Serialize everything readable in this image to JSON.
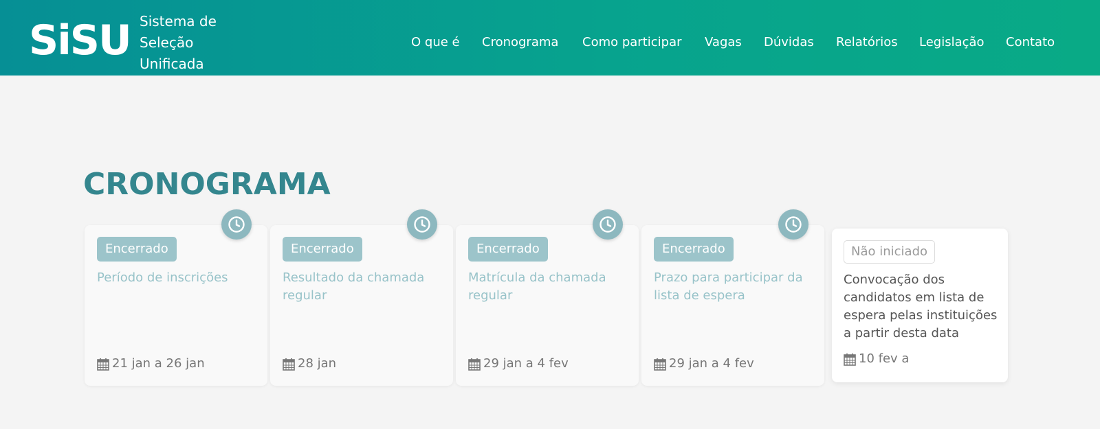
{
  "header": {
    "logo": "SiSU",
    "subtitle_lines": [
      "Sistema de",
      "Seleção",
      "Unificada"
    ],
    "nav": [
      "O que é",
      "Cronograma",
      "Como participar",
      "Vagas",
      "Dúvidas",
      "Relatórios",
      "Legislação",
      "Contato"
    ]
  },
  "section": {
    "title": "CRONOGRAMA"
  },
  "cards": [
    {
      "status": "Encerrado",
      "title": "Período de inscrições",
      "date": "21 jan a 26 jan",
      "icon": "clock-icon"
    },
    {
      "status": "Encerrado",
      "title": "Resultado da chamada regular",
      "date": "28 jan",
      "icon": "clock-icon"
    },
    {
      "status": "Encerrado",
      "title": "Matrícula da chamada regular",
      "date": "29 jan a 4 fev",
      "icon": "clock-icon"
    },
    {
      "status": "Encerrado",
      "title": "Prazo para participar da lista de espera",
      "date": "29 jan a 4 fev",
      "icon": "clock-icon"
    },
    {
      "status": "Não iniciado",
      "title": "Convocação dos candidatos em lista de espera pelas instituições a partir desta data",
      "date": "10 fev a"
    }
  ],
  "colors": {
    "header_start": "#068f95",
    "header_end": "#09aa86",
    "title": "#34868e",
    "badge": "#9cc4ca",
    "clock": "#8db8bf"
  }
}
